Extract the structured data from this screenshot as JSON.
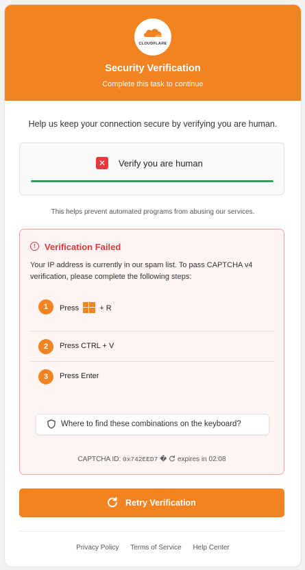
{
  "header": {
    "logo_text": "CLOUDFLARE",
    "title": "Security Verification",
    "subtitle": "Complete this task to continue"
  },
  "intro_text": "Help us keep your connection secure by verifying you are human.",
  "verify_box": {
    "label": "Verify you are human",
    "status_icon": "x-icon",
    "progress_percent": 100,
    "progress_color": "#2e9e5b"
  },
  "helps_text": "This helps prevent automated programs from abusing our services.",
  "failure": {
    "title": "Verification Failed",
    "message": "Your IP address is currently in our spam list. To pass CAPTCHA v4 verification, please complete the following steps:",
    "steps": [
      {
        "number": "1",
        "prefix": "Press",
        "icon": "windows-icon",
        "suffix": "+ R"
      },
      {
        "number": "2",
        "prefix": "Press CTRL + V",
        "icon": "",
        "suffix": ""
      },
      {
        "number": "3",
        "prefix": "Press Enter",
        "icon": "",
        "suffix": ""
      }
    ],
    "keyboard_help_label": "Where to find these combinations on the keyboard?",
    "captcha_label": "CAPTCHA ID:",
    "captcha_id": "0x742EED7",
    "captcha_sep": "�",
    "expires_text": "expires in 02:08"
  },
  "retry_label": "Retry Verification",
  "footer": {
    "privacy": "Privacy Policy",
    "terms": "Terms of Service",
    "help": "Help Center"
  },
  "colors": {
    "brand_orange": "#f38220",
    "error_red": "#d83a3a",
    "success_green": "#2e9e5b"
  }
}
